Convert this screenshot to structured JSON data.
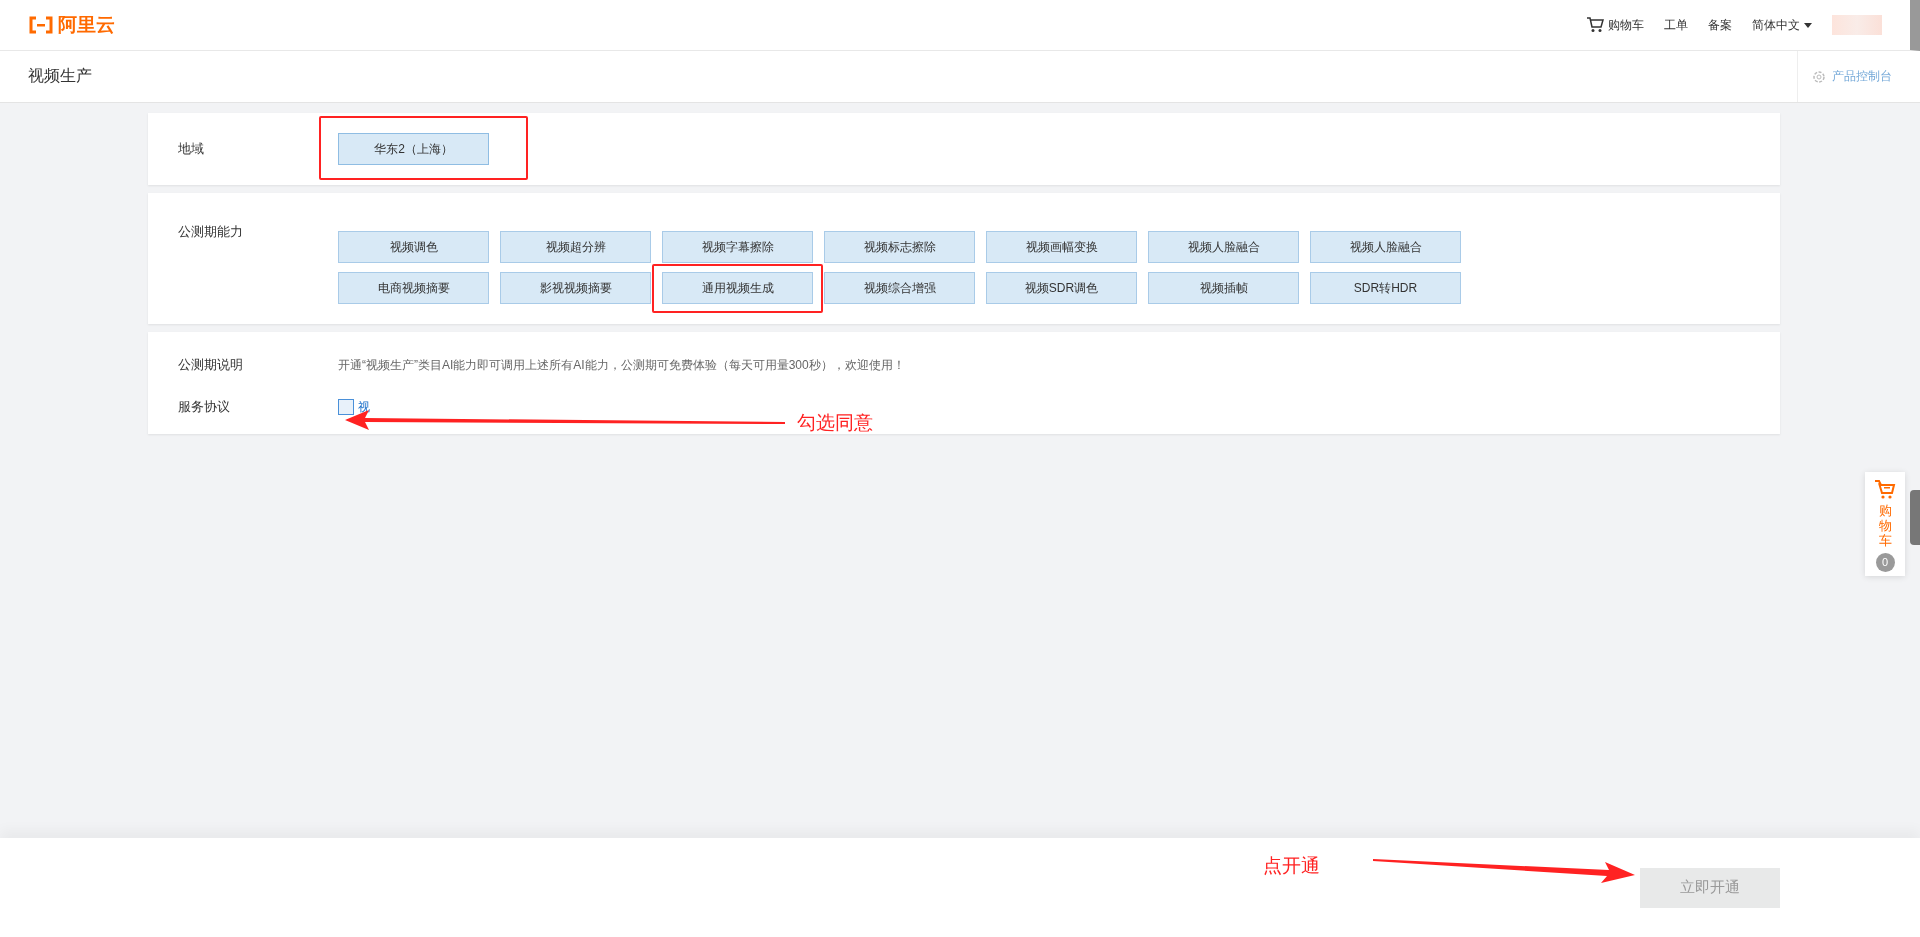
{
  "header": {
    "logo": "阿里云",
    "nav": [
      {
        "label": "购物车",
        "kind": "cart"
      },
      {
        "label": "工单",
        "kind": "plain"
      },
      {
        "label": "备案",
        "kind": "plain"
      },
      {
        "label": "简体中文",
        "kind": "dropdown"
      }
    ]
  },
  "title_bar": {
    "title": "视频生产",
    "console_link": "产品控制台"
  },
  "region": {
    "label": "地域",
    "options": [
      {
        "label": "华东2（上海）",
        "selected": true
      }
    ]
  },
  "capabilities": {
    "label": "公测期能力",
    "items": [
      {
        "label": "视频调色"
      },
      {
        "label": "视频超分辨"
      },
      {
        "label": "视频字幕擦除"
      },
      {
        "label": "视频标志擦除"
      },
      {
        "label": "视频画幅变换"
      },
      {
        "label": "视频人脸融合"
      },
      {
        "label": "视频人脸融合"
      },
      {
        "label": "电商视频摘要"
      },
      {
        "label": "影视视频摘要"
      },
      {
        "label": "通用视频生成"
      },
      {
        "label": "视频综合增强"
      },
      {
        "label": "视频SDR调色"
      },
      {
        "label": "视频插帧"
      },
      {
        "label": "SDR转HDR"
      }
    ]
  },
  "notes": {
    "label": "公测期说明",
    "text": "开通“视频生产”类目AI能力即可调用上述所有AI能力，公测期可免费体验（每天可用量300秒），欢迎使用！"
  },
  "agreement": {
    "label": "服务协议",
    "checked": false,
    "link": "视"
  },
  "footer": {
    "submit": {
      "label": "立即开通",
      "disabled": true
    }
  },
  "cart_widget": {
    "label": "购物车",
    "count": "0"
  },
  "annotations": [
    {
      "text": "勾选同意"
    },
    {
      "text": "点开通"
    }
  ]
}
